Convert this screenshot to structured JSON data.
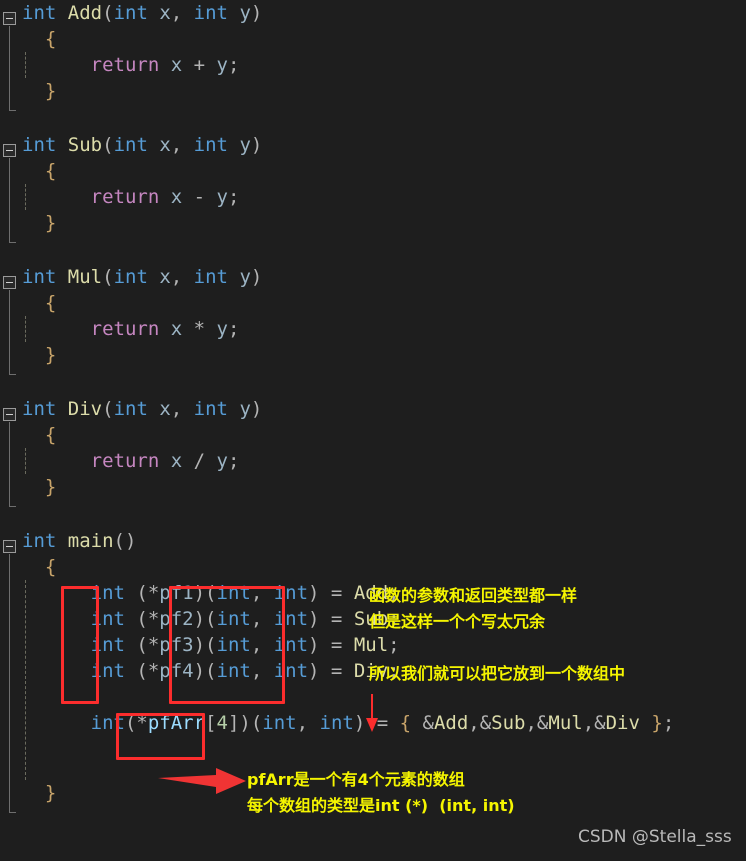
{
  "editor": {
    "background_color": "#1e1e1e",
    "theme": "dark-vs-code",
    "language": "c"
  },
  "colors": {
    "keyword": "#569cd6",
    "return_keyword": "#c586c0",
    "function_name": "#dcdcaa",
    "variable": "#9cb4c4",
    "punctuation": "#b4b4b4",
    "brace": "#c8a46a",
    "number": "#b5cea8",
    "identifier": "#9cdcfe",
    "annotation_yellow": "#f5f500",
    "annotation_red": "#fc2d2d",
    "watermark_gray": "#b9b9b9"
  },
  "code_lines": [
    {
      "id": "add-signature",
      "text": "int Add(int x, int y)",
      "fold": true
    },
    {
      "id": "add-open",
      "text": "  {"
    },
    {
      "id": "add-return",
      "text": "      return x + y;"
    },
    {
      "id": "add-close",
      "text": "  }"
    },
    {
      "id": "blank-1",
      "text": ""
    },
    {
      "id": "sub-signature",
      "text": "int Sub(int x, int y)",
      "fold": true
    },
    {
      "id": "sub-open",
      "text": "  {"
    },
    {
      "id": "sub-return",
      "text": "      return x - y;"
    },
    {
      "id": "sub-close",
      "text": "  }"
    },
    {
      "id": "blank-2",
      "text": ""
    },
    {
      "id": "mul-signature",
      "text": "int Mul(int x, int y)",
      "fold": true
    },
    {
      "id": "mul-open",
      "text": "  {"
    },
    {
      "id": "mul-return",
      "text": "      return x * y;"
    },
    {
      "id": "mul-close",
      "text": "  }"
    },
    {
      "id": "blank-3",
      "text": ""
    },
    {
      "id": "div-signature",
      "text": "int Div(int x, int y)",
      "fold": true
    },
    {
      "id": "div-open",
      "text": "  {"
    },
    {
      "id": "div-return",
      "text": "      return x / y;"
    },
    {
      "id": "div-close",
      "text": "  }"
    },
    {
      "id": "blank-4",
      "text": ""
    },
    {
      "id": "main-signature",
      "text": "int main()",
      "fold": true
    },
    {
      "id": "main-open",
      "text": "  {"
    },
    {
      "id": "pf1",
      "text": "      int (*pf1)(int, int) = Add;"
    },
    {
      "id": "pf2",
      "text": "      int (*pf2)(int, int) = Sub;"
    },
    {
      "id": "pf3",
      "text": "      int (*pf3)(int, int) = Mul;"
    },
    {
      "id": "pf4",
      "text": "      int (*pf4)(int, int) = Div;"
    },
    {
      "id": "blank-5",
      "text": ""
    },
    {
      "id": "pfarr",
      "text": "      int(*pfArr[4])(int, int) = { &Add,&Sub,&Mul,&Div };"
    },
    {
      "id": "blank-6",
      "text": ""
    },
    {
      "id": "main-close",
      "text": "  }"
    }
  ],
  "annotations": {
    "note_params_same": "函数的参数和返回类型都一样",
    "note_too_verbose": "但是这样一个个写太冗余",
    "note_put_in_array": "所以我们就可以把它放到一个数组中",
    "note_pfarr_desc": "pfArr是一个有4个元素的数组",
    "note_pfarr_type": "每个数组的类型是int (*)  (int, int)",
    "redbox_int_column_label": "highlight-int-return-type",
    "redbox_params_label": "highlight-int-int-params",
    "redbox_pfarr_label": "highlight-pfArr-4",
    "arrow_down_label": "red-down-arrow",
    "arrow_right_label": "red-right-arrow"
  },
  "watermark": {
    "text": "CSDN @Stella_sss"
  }
}
